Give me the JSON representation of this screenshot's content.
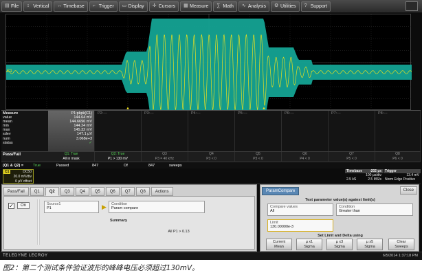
{
  "menu": [
    {
      "label": "File",
      "icon": "file-icon",
      "glyph": "▤"
    },
    {
      "label": "Vertical",
      "icon": "vertical-icon",
      "glyph": "↕"
    },
    {
      "label": "Timebase",
      "icon": "timebase-icon",
      "glyph": "↔"
    },
    {
      "label": "Trigger",
      "icon": "trigger-icon",
      "glyph": "⌐"
    },
    {
      "label": "Display",
      "icon": "display-icon",
      "glyph": "▭"
    },
    {
      "label": "Cursors",
      "icon": "cursors-icon",
      "glyph": "✛"
    },
    {
      "label": "Measure",
      "icon": "measure-icon",
      "glyph": "▦"
    },
    {
      "label": "Math",
      "icon": "math-icon",
      "glyph": "∑"
    },
    {
      "label": "Analysis",
      "icon": "analysis-icon",
      "glyph": "∿"
    },
    {
      "label": "Utilities",
      "icon": "utilities-icon",
      "glyph": "⚙"
    },
    {
      "label": "Support",
      "icon": "support-icon",
      "glyph": "?"
    }
  ],
  "grid": {
    "channel_label": "C1",
    "trace_color": "#e8e020",
    "mask_color": "#14a394"
  },
  "measure": {
    "labels": [
      "Measure",
      "value",
      "mean",
      "min",
      "max",
      "sdev",
      "num",
      "status"
    ],
    "p1": {
      "header": "P1:pkpk(C1)",
      "values": [
        "144.64 mV",
        "144.6696 mV",
        "144.24 mV",
        "145.32 mV",
        "147.1 µV",
        "3.068e+3",
        ""
      ]
    },
    "other": [
      "P2:---",
      "P3:---",
      "P4:---",
      "P5:---",
      "P6:---",
      "P7:---",
      "P8:---"
    ]
  },
  "passfail": {
    "label": "Pass/Fail",
    "cols": [
      {
        "l1": "Q1: True",
        "l2": "All in mask"
      },
      {
        "l1": "Q2: True",
        "l2": "P1 > 130 mV"
      },
      {
        "l1": "Q3",
        "l2": "P3 = 40 kHz"
      },
      {
        "l1": "Q4",
        "l2": "P3 < 0"
      },
      {
        "l1": "Q5",
        "l2": "P3 < 0"
      },
      {
        "l1": "Q6",
        "l2": "P4 < 0"
      },
      {
        "l1": "Q7",
        "l2": "P5 < 0"
      },
      {
        "l1": "Q8",
        "l2": "P6 < 0"
      }
    ]
  },
  "summary_row": {
    "label": "(Q1 & Q2) =",
    "result": "True",
    "passed_label": "Passed",
    "passed": "847",
    "of_label": "Of",
    "total": "847",
    "sweeps_label": "sweeps"
  },
  "channel": {
    "tag": "C1",
    "coupling": "DC50",
    "vdiv": "20.0 mV/div",
    "offset": "0 µV offset"
  },
  "timebase": {
    "header": "Timebase",
    "delay": "-202 µs",
    "tdiv": "100 µs/div",
    "samples": "2.5 kS",
    "rate": "2.5 MS/s",
    "memory": "13.4 mV"
  },
  "trigger": {
    "header": "Trigger",
    "mode": "Norm",
    "type": "Edge",
    "slope": "Positive"
  },
  "dialog": {
    "tabs": [
      "Pass/Fail",
      "Q1",
      "Q2",
      "Q3",
      "Q4",
      "Q5",
      "Q6",
      "Q7",
      "Q8",
      "Actions"
    ],
    "active_tab": "Q2",
    "on_label": "On",
    "source_label": "Source1",
    "source_value": "P1",
    "condition_label": "Condition",
    "condition_value": "Param compare",
    "summary_header": "Summary",
    "summary_value": "All P1 > 0.13"
  },
  "rpanel": {
    "tab": "ParamCompare",
    "close": "Close",
    "title": "Test parameter value(s) against limit(s)",
    "compare_label": "Compare values",
    "compare_value": "All",
    "condition_label": "Condition",
    "condition_value": "Greater than",
    "limit_label": "Limit",
    "limit_value": "130.00000e-3",
    "delta_title": "Set Limit and Delta using",
    "buttons": [
      {
        "l1": "Current",
        "l2": "Mean"
      },
      {
        "l1": "µ x1",
        "l2": "Sigma"
      },
      {
        "l1": "µ x3",
        "l2": "Sigma"
      },
      {
        "l1": "µ x5",
        "l2": "Sigma"
      },
      {
        "l1": "Clear",
        "l2": "Sweeps"
      }
    ]
  },
  "status": {
    "brand": "TELEDYNE LECROY",
    "datetime": "6/5/2014 1:37:18 PM"
  },
  "caption": "图2：第二个测试条件验证波形的峰峰电压必须超过130mV。"
}
